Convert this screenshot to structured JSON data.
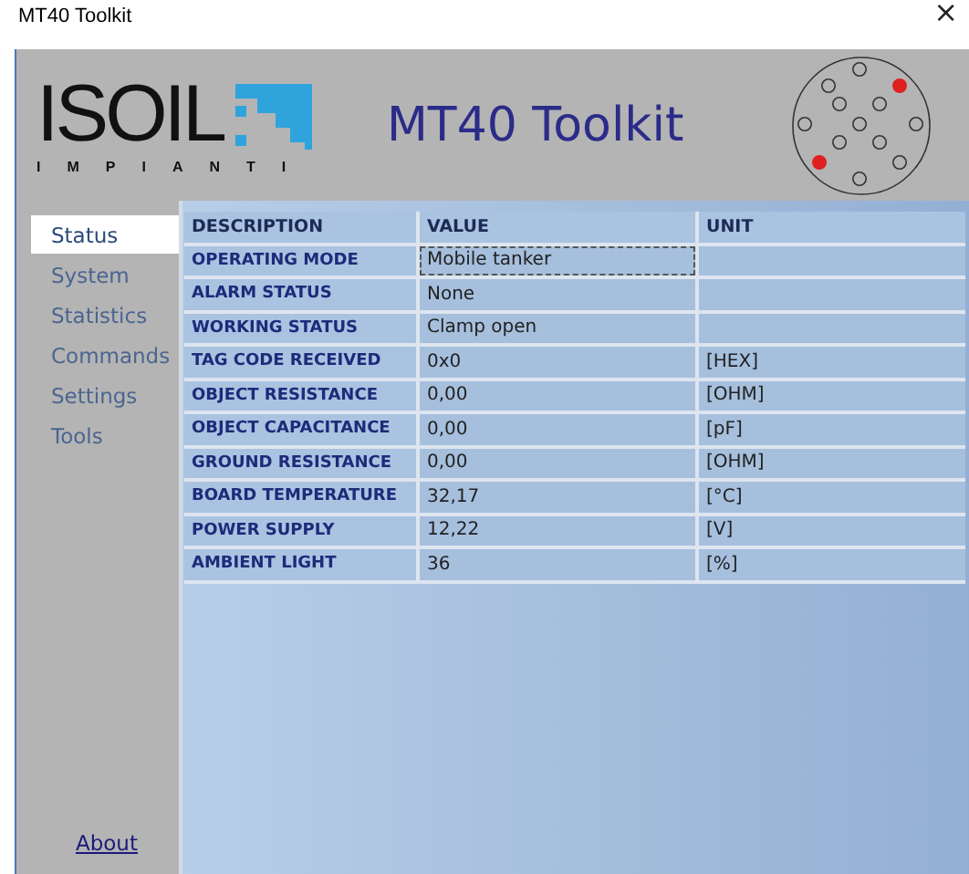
{
  "window": {
    "title": "MT40 Toolkit",
    "close": "×"
  },
  "header": {
    "logo_text": "ISOIL",
    "logo_subtext": "IMPIANTI",
    "title": "MT40 Toolkit",
    "connector_pins": [
      {
        "active": false
      },
      {
        "active": true
      },
      {
        "active": false
      },
      {
        "active": false
      },
      {
        "active": false
      },
      {
        "active": false
      },
      {
        "active": false
      },
      {
        "active": false
      },
      {
        "active": false
      },
      {
        "active": false
      },
      {
        "active": true
      },
      {
        "active": false
      },
      {
        "active": false
      }
    ]
  },
  "sidebar": {
    "items": [
      {
        "label": "Status",
        "selected": true
      },
      {
        "label": "System",
        "selected": false
      },
      {
        "label": "Statistics",
        "selected": false
      },
      {
        "label": "Commands",
        "selected": false
      },
      {
        "label": "Settings",
        "selected": false
      },
      {
        "label": "Tools",
        "selected": false
      }
    ],
    "footer_link": "About"
  },
  "table": {
    "columns": [
      "DESCRIPTION",
      "VALUE",
      "UNIT"
    ],
    "rows": [
      {
        "description": "OPERATING MODE",
        "value": "Mobile tanker",
        "unit": "",
        "focused": true
      },
      {
        "description": "ALARM STATUS",
        "value": "None",
        "unit": "",
        "focused": false
      },
      {
        "description": "WORKING STATUS",
        "value": "Clamp open",
        "unit": "",
        "focused": false
      },
      {
        "description": "TAG CODE RECEIVED",
        "value": "0x0",
        "unit": "[HEX]",
        "focused": false
      },
      {
        "description": "OBJECT RESISTANCE",
        "value": "0,00",
        "unit": "[OHM]",
        "focused": false
      },
      {
        "description": "OBJECT CAPACITANCE",
        "value": "0,00",
        "unit": "[pF]",
        "focused": false
      },
      {
        "description": "GROUND RESISTANCE",
        "value": "0,00",
        "unit": "[OHM]",
        "focused": false
      },
      {
        "description": "BOARD TEMPERATURE",
        "value": "32,17",
        "unit": "[°C]",
        "focused": false
      },
      {
        "description": "POWER SUPPLY",
        "value": "12,22",
        "unit": "[V]",
        "focused": false
      },
      {
        "description": "AMBIENT LIGHT",
        "value": "36",
        "unit": "[%]",
        "focused": false
      }
    ]
  }
}
